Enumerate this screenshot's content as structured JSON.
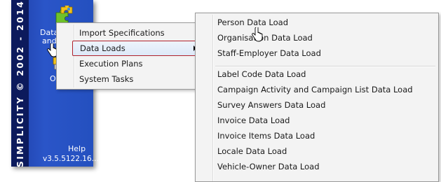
{
  "app_panel": {
    "vertical_text": "SIMPLICITY © 2002 - 2014",
    "data_label_line1": "Data",
    "data_label_line2": "and",
    "other_label": "O",
    "help_label": "Help",
    "version": "v3.5.5122.16..."
  },
  "context_menu": {
    "items": [
      {
        "label": "Import Specifications"
      },
      {
        "label": "Data Loads",
        "selected": true,
        "has_submenu": true
      },
      {
        "label": "Execution Plans"
      },
      {
        "label": "System Tasks"
      }
    ]
  },
  "submenu": {
    "items": [
      {
        "label": "Person Data Load"
      },
      {
        "label": "Organisation Data Load"
      },
      {
        "label": "Staff-Employer Data Load"
      },
      {
        "label": "Label Code Data Load"
      },
      {
        "label": "Campaign Activity and Campaign List Data Load"
      },
      {
        "label": "Survey Answers Data Load"
      },
      {
        "label": "Invoice Data Load"
      },
      {
        "label": "Invoice Items Data Load"
      },
      {
        "label": "Locale Data Load"
      },
      {
        "label": "Vehicle-Owner Data Load"
      }
    ]
  },
  "icons": {
    "puzzle": "puzzle-icon",
    "hand_cursor": "hand-cursor-icon",
    "submenu_arrow": "chevron-right-icon"
  }
}
